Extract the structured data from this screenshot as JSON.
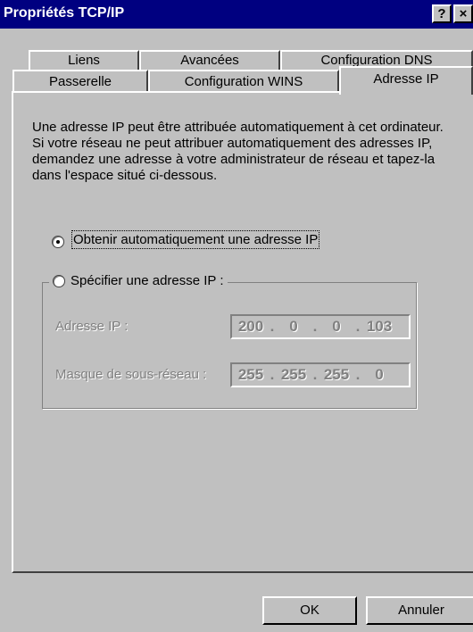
{
  "window": {
    "title": "Propriétés TCP/IP",
    "help_glyph": "?",
    "close_glyph": "×",
    "colors": {
      "titlebar": "#000080",
      "face": "#c0c0c0",
      "disabled_text": "#808080"
    }
  },
  "tabs": {
    "back_row": [
      "Liens",
      "Avancées",
      "Configuration DNS"
    ],
    "front_row": [
      "Passerelle",
      "Configuration WINS",
      "Adresse IP"
    ],
    "active": "Adresse IP"
  },
  "panel": {
    "description": "Une adresse IP peut être attribuée automatiquement à cet ordinateur. Si votre réseau ne peut attribuer automatiquement des adresses IP, demandez une adresse à votre administrateur de réseau et tapez-la dans l'espace situé ci-dessous.",
    "radio_auto_label": "Obtenir automatiquement une adresse IP",
    "radio_auto_selected": true,
    "radio_specify_label": "Spécifier une adresse IP :",
    "radio_specify_selected": false,
    "ip_label": "Adresse IP :",
    "ip": {
      "o1": "200",
      "o2": "0",
      "o3": "0",
      "o4": "103"
    },
    "mask_label": "Masque de sous-réseau :",
    "mask": {
      "o1": "255",
      "o2": "255",
      "o3": "255",
      "o4": "0"
    }
  },
  "buttons": {
    "ok": "OK",
    "cancel": "Annuler"
  }
}
